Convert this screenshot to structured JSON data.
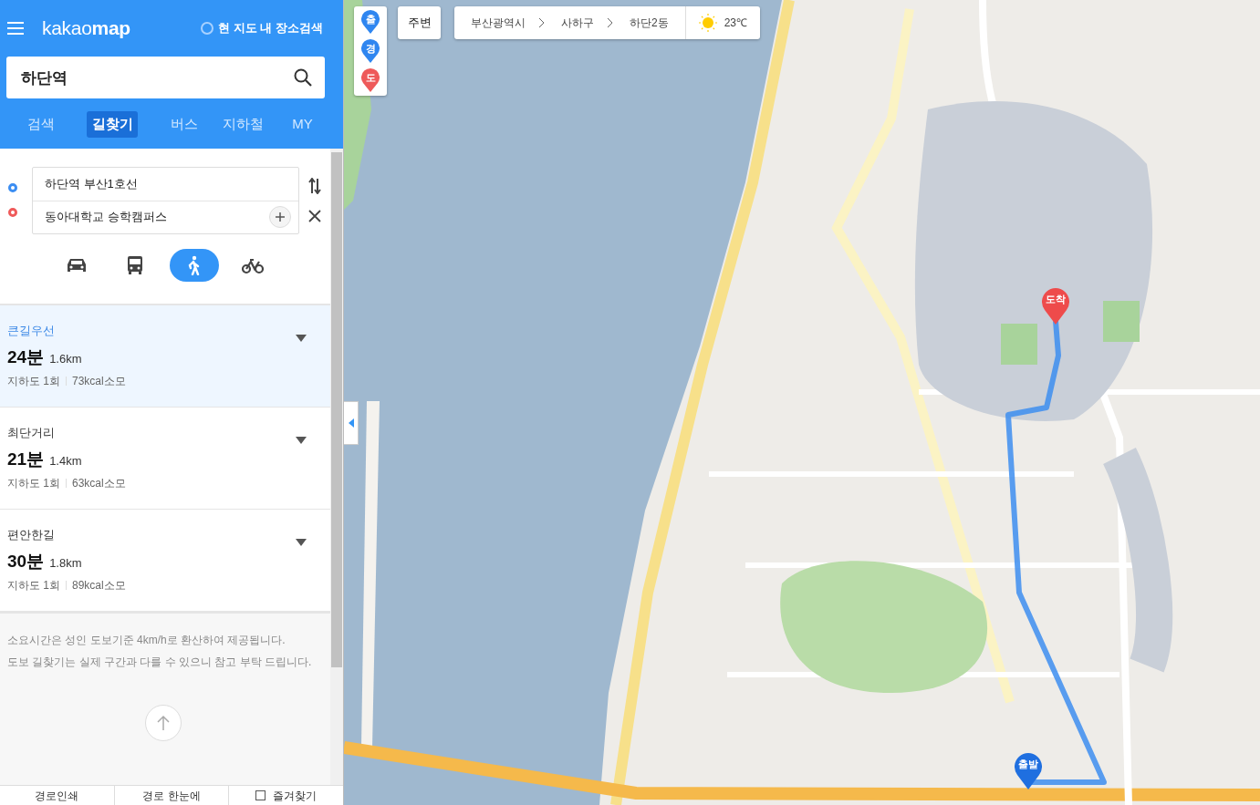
{
  "header": {
    "logo": "kakaomap",
    "area_search": {
      "label": "현 지도 내 장소검색",
      "checked": false
    }
  },
  "search": {
    "value": "하단역"
  },
  "tabs": [
    {
      "label": "검색",
      "selected": false
    },
    {
      "label": "길찾기",
      "selected": true
    },
    {
      "label": "버스",
      "selected": false
    },
    {
      "label": "지하철",
      "selected": false
    },
    {
      "label": "MY",
      "selected": false
    }
  ],
  "route_inputs": [
    {
      "kind": "origin",
      "value": "하단역 부산1호선"
    },
    {
      "kind": "destination",
      "value": "동아대학교 승학캠퍼스"
    }
  ],
  "modes": [
    {
      "kind": "car",
      "selected": false
    },
    {
      "kind": "bus",
      "selected": false
    },
    {
      "kind": "walk",
      "selected": true
    },
    {
      "kind": "bike",
      "selected": false
    }
  ],
  "routes": [
    {
      "name": "큰길우선",
      "time": "24분",
      "distance": "1.6km",
      "underpass": "지하도 1회",
      "calories": "73kcal소모",
      "selected": true
    },
    {
      "name": "최단거리",
      "time": "21분",
      "distance": "1.4km",
      "underpass": "지하도 1회",
      "calories": "63kcal소모",
      "selected": false
    },
    {
      "name": "편안한길",
      "time": "30분",
      "distance": "1.8km",
      "underpass": "지하도 1회",
      "calories": "89kcal소모",
      "selected": false
    }
  ],
  "notes": [
    "소요시간은 성인 도보기준 4km/h로 환산하여 제공됩니다.",
    "도보 길찾기는 실제 구간과 다를 수 있으니 참고 부탁 드립니다."
  ],
  "footer": [
    {
      "kind": "button",
      "label": "경로인쇄"
    },
    {
      "kind": "button",
      "label": "경로 한눈에"
    },
    {
      "kind": "checkbox",
      "label": "즐겨찾기",
      "checked": false
    }
  ],
  "map": {
    "pin_legend": [
      {
        "label": "출",
        "color": "#2f86f0"
      },
      {
        "label": "경",
        "color": "#2f86f0"
      },
      {
        "label": "도",
        "color": "#ee5a5a"
      }
    ],
    "nearby_button": "주변",
    "breadcrumb": [
      "부산광역시",
      "사하구",
      "하단2동"
    ],
    "weather": "23℃",
    "route_pins": [
      {
        "kind": "end",
        "label": "도착"
      },
      {
        "kind": "start",
        "label": "출발"
      }
    ]
  }
}
